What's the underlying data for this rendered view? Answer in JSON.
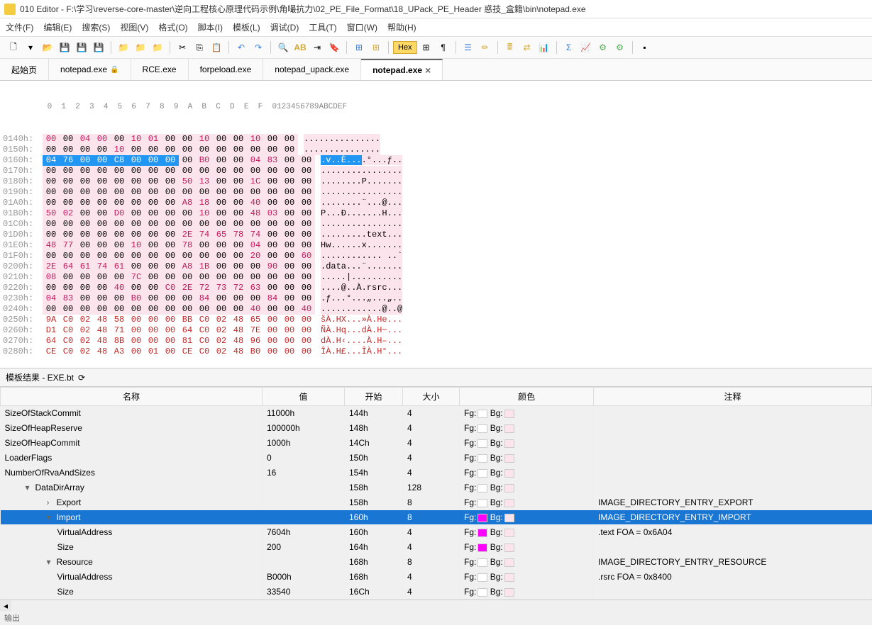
{
  "title": "010 Editor - F:\\学习\\reverse-core-master\\逆向工程核心原理代码示例\\角嘬抗力\\02_PE_File_Format\\18_UPack_PE_Header 惑技_盒籍\\bin\\notepad.exe",
  "menu": [
    {
      "l": "文件(F)"
    },
    {
      "l": "编辑(E)"
    },
    {
      "l": "搜索(S)"
    },
    {
      "l": "视图(V)"
    },
    {
      "l": "格式(O)"
    },
    {
      "l": "脚本(I)"
    },
    {
      "l": "模板(L)"
    },
    {
      "l": "调试(D)"
    },
    {
      "l": "工具(T)"
    },
    {
      "l": "窗口(W)"
    },
    {
      "l": "帮助(H)"
    }
  ],
  "toolbar_hex": "Hex",
  "tabs": [
    {
      "l": "起始页",
      "active": false
    },
    {
      "l": "notepad.exe",
      "active": false,
      "locked": true
    },
    {
      "l": "RCE.exe",
      "active": false
    },
    {
      "l": "forpeload.exe",
      "active": false
    },
    {
      "l": "notepad_upack.exe",
      "active": false
    },
    {
      "l": "notepad.exe",
      "active": true,
      "close": true
    }
  ],
  "hex_ruler_bytes": " 0  1  2  3  4  5  6  7  8  9  A  B  C  D  E  F",
  "hex_ruler_ascii": "0123456789ABCDEF",
  "hex_rows": [
    {
      "addr": "0140h:",
      "bytes": [
        "00",
        "00",
        "04",
        "00",
        "00",
        "10",
        "01",
        "00",
        "00",
        "10",
        "00",
        "00",
        "10",
        "00",
        "00"
      ],
      "bm": [
        1,
        0,
        1,
        1,
        0,
        1,
        1,
        0,
        0,
        1,
        0,
        0,
        1,
        0,
        0
      ],
      "ascii": "...............",
      "style": "pink"
    },
    {
      "addr": "0150h:",
      "bytes": [
        "00",
        "00",
        "00",
        "00",
        "10",
        "00",
        "00",
        "00",
        "00",
        "00",
        "00",
        "00",
        "00",
        "00",
        "00"
      ],
      "bm": [
        0,
        0,
        0,
        0,
        1,
        0,
        0,
        0,
        0,
        0,
        0,
        0,
        0,
        0,
        0
      ],
      "ascii": "...............",
      "style": "pink"
    },
    {
      "addr": "0160h:",
      "bytes": [
        "04",
        "76",
        "00",
        "00",
        "C8",
        "00",
        "00",
        "00",
        "00",
        "B0",
        "00",
        "00",
        "04",
        "83",
        "00",
        "00"
      ],
      "bm": [
        1,
        1,
        0,
        0,
        1,
        0,
        0,
        0,
        0,
        1,
        0,
        0,
        1,
        1,
        0,
        0
      ],
      "ascii": ".v..È....°...ƒ..",
      "style": "pink",
      "sel_start": 0,
      "sel_end": 7,
      "ascii_sel": 8
    },
    {
      "addr": "0170h:",
      "bytes": [
        "00",
        "00",
        "00",
        "00",
        "00",
        "00",
        "00",
        "00",
        "00",
        "00",
        "00",
        "00",
        "00",
        "00",
        "00",
        "00"
      ],
      "bm": [
        0,
        0,
        0,
        0,
        0,
        0,
        0,
        0,
        0,
        0,
        0,
        0,
        0,
        0,
        0,
        0
      ],
      "ascii": "................",
      "style": "pink"
    },
    {
      "addr": "0180h:",
      "bytes": [
        "00",
        "00",
        "00",
        "00",
        "00",
        "00",
        "00",
        "00",
        "50",
        "13",
        "00",
        "00",
        "1C",
        "00",
        "00",
        "00"
      ],
      "bm": [
        0,
        0,
        0,
        0,
        0,
        0,
        0,
        0,
        1,
        1,
        0,
        0,
        1,
        0,
        0,
        0
      ],
      "ascii": "........P.......",
      "style": "pink"
    },
    {
      "addr": "0190h:",
      "bytes": [
        "00",
        "00",
        "00",
        "00",
        "00",
        "00",
        "00",
        "00",
        "00",
        "00",
        "00",
        "00",
        "00",
        "00",
        "00",
        "00"
      ],
      "bm": [
        0,
        0,
        0,
        0,
        0,
        0,
        0,
        0,
        0,
        0,
        0,
        0,
        0,
        0,
        0,
        0
      ],
      "ascii": "................",
      "style": "pink"
    },
    {
      "addr": "01A0h:",
      "bytes": [
        "00",
        "00",
        "00",
        "00",
        "00",
        "00",
        "00",
        "00",
        "A8",
        "18",
        "00",
        "00",
        "40",
        "00",
        "00",
        "00"
      ],
      "bm": [
        0,
        0,
        0,
        0,
        0,
        0,
        0,
        0,
        1,
        1,
        0,
        0,
        1,
        0,
        0,
        0
      ],
      "ascii": "........¨...@...",
      "style": "pink"
    },
    {
      "addr": "01B0h:",
      "bytes": [
        "50",
        "02",
        "00",
        "00",
        "D0",
        "00",
        "00",
        "00",
        "00",
        "10",
        "00",
        "00",
        "48",
        "03",
        "00",
        "00"
      ],
      "bm": [
        1,
        1,
        0,
        0,
        1,
        0,
        0,
        0,
        0,
        1,
        0,
        0,
        1,
        1,
        0,
        0
      ],
      "ascii": "P...Ð.......H...",
      "style": "pink"
    },
    {
      "addr": "01C0h:",
      "bytes": [
        "00",
        "00",
        "00",
        "00",
        "00",
        "00",
        "00",
        "00",
        "00",
        "00",
        "00",
        "00",
        "00",
        "00",
        "00",
        "00"
      ],
      "bm": [
        0,
        0,
        0,
        0,
        0,
        0,
        0,
        0,
        0,
        0,
        0,
        0,
        0,
        0,
        0,
        0
      ],
      "ascii": "................",
      "style": "pink"
    },
    {
      "addr": "01D0h:",
      "bytes": [
        "00",
        "00",
        "00",
        "00",
        "00",
        "00",
        "00",
        "00",
        "2E",
        "74",
        "65",
        "78",
        "74",
        "00",
        "00",
        "00"
      ],
      "bm": [
        0,
        0,
        0,
        0,
        0,
        0,
        0,
        0,
        1,
        1,
        1,
        1,
        1,
        0,
        0,
        0
      ],
      "ascii": ".........text...",
      "style": "pink"
    },
    {
      "addr": "01E0h:",
      "bytes": [
        "48",
        "77",
        "00",
        "00",
        "00",
        "10",
        "00",
        "00",
        "78",
        "00",
        "00",
        "00",
        "04",
        "00",
        "00",
        "00"
      ],
      "bm": [
        1,
        1,
        0,
        0,
        0,
        1,
        0,
        0,
        1,
        0,
        0,
        0,
        1,
        0,
        0,
        0
      ],
      "ascii": "Hw......x.......",
      "style": "pink"
    },
    {
      "addr": "01F0h:",
      "bytes": [
        "00",
        "00",
        "00",
        "00",
        "00",
        "00",
        "00",
        "00",
        "00",
        "00",
        "00",
        "00",
        "20",
        "00",
        "00",
        "60"
      ],
      "bm": [
        0,
        0,
        0,
        0,
        0,
        0,
        0,
        0,
        0,
        0,
        0,
        0,
        1,
        0,
        0,
        1
      ],
      "ascii": "............ ..`",
      "style": "pink"
    },
    {
      "addr": "0200h:",
      "bytes": [
        "2E",
        "64",
        "61",
        "74",
        "61",
        "00",
        "00",
        "00",
        "A8",
        "1B",
        "00",
        "00",
        "00",
        "90",
        "00",
        "00"
      ],
      "bm": [
        1,
        1,
        1,
        1,
        1,
        0,
        0,
        0,
        1,
        1,
        0,
        0,
        0,
        1,
        0,
        0
      ],
      "ascii": ".data...¨.......",
      "style": "pink"
    },
    {
      "addr": "0210h:",
      "bytes": [
        "08",
        "00",
        "00",
        "00",
        "00",
        "7C",
        "00",
        "00",
        "00",
        "00",
        "00",
        "00",
        "00",
        "00",
        "00",
        "00"
      ],
      "bm": [
        1,
        0,
        0,
        0,
        0,
        1,
        0,
        0,
        0,
        0,
        0,
        0,
        0,
        0,
        0,
        0
      ],
      "ascii": ".....|..........",
      "style": "pink"
    },
    {
      "addr": "0220h:",
      "bytes": [
        "00",
        "00",
        "00",
        "00",
        "40",
        "00",
        "00",
        "C0",
        "2E",
        "72",
        "73",
        "72",
        "63",
        "00",
        "00",
        "00"
      ],
      "bm": [
        0,
        0,
        0,
        0,
        1,
        0,
        0,
        1,
        1,
        1,
        1,
        1,
        1,
        0,
        0,
        0
      ],
      "ascii": "....@..À.rsrc...",
      "style": "pink"
    },
    {
      "addr": "0230h:",
      "bytes": [
        "04",
        "83",
        "00",
        "00",
        "00",
        "B0",
        "00",
        "00",
        "00",
        "84",
        "00",
        "00",
        "00",
        "84",
        "00",
        "00"
      ],
      "bm": [
        1,
        1,
        0,
        0,
        0,
        1,
        0,
        0,
        0,
        1,
        0,
        0,
        0,
        1,
        0,
        0
      ],
      "ascii": ".ƒ...°...„...„..",
      "style": "pink"
    },
    {
      "addr": "0240h:",
      "bytes": [
        "00",
        "00",
        "00",
        "00",
        "00",
        "00",
        "00",
        "00",
        "00",
        "00",
        "00",
        "00",
        "40",
        "00",
        "00",
        "40"
      ],
      "bm": [
        0,
        0,
        0,
        0,
        0,
        0,
        0,
        0,
        0,
        0,
        0,
        0,
        1,
        0,
        0,
        1
      ],
      "ascii": "............@..@",
      "style": "pink"
    },
    {
      "addr": "0250h:",
      "bytes": [
        "9A",
        "C0",
        "02",
        "48",
        "58",
        "00",
        "00",
        "00",
        "BB",
        "C0",
        "02",
        "48",
        "65",
        "00",
        "00",
        "00"
      ],
      "bm": [
        0,
        0,
        0,
        0,
        0,
        0,
        0,
        0,
        0,
        0,
        0,
        0,
        0,
        0,
        0,
        0
      ],
      "ascii": "šÀ.HX...»À.He...",
      "style": "red"
    },
    {
      "addr": "0260h:",
      "bytes": [
        "D1",
        "C0",
        "02",
        "48",
        "71",
        "00",
        "00",
        "00",
        "64",
        "C0",
        "02",
        "48",
        "7E",
        "00",
        "00",
        "00"
      ],
      "bm": [
        0,
        0,
        0,
        0,
        0,
        0,
        0,
        0,
        0,
        0,
        0,
        0,
        0,
        0,
        0,
        0
      ],
      "ascii": "ÑÀ.Hq...dÀ.H~...",
      "style": "red"
    },
    {
      "addr": "0270h:",
      "bytes": [
        "64",
        "C0",
        "02",
        "48",
        "8B",
        "00",
        "00",
        "00",
        "81",
        "C0",
        "02",
        "48",
        "96",
        "00",
        "00",
        "00"
      ],
      "bm": [
        0,
        0,
        0,
        0,
        0,
        0,
        0,
        0,
        0,
        0,
        0,
        0,
        0,
        0,
        0,
        0
      ],
      "ascii": "dÀ.H‹....À.H–...",
      "style": "red"
    },
    {
      "addr": "0280h:",
      "bytes": [
        "CE",
        "C0",
        "02",
        "48",
        "A3",
        "00",
        "01",
        "00",
        "CE",
        "C0",
        "02",
        "48",
        "B0",
        "00",
        "00",
        "00"
      ],
      "bm": [
        0,
        0,
        0,
        0,
        0,
        0,
        0,
        0,
        0,
        0,
        0,
        0,
        0,
        0,
        0,
        0
      ],
      "ascii": "ÎÀ.H£...ÎÀ.H°...",
      "style": "red"
    }
  ],
  "panel": {
    "title": "模板结果 - EXE.bt",
    "headers": {
      "name": "名称",
      "value": "值",
      "start": "开始",
      "size": "大小",
      "color": "颜色",
      "comment": "注释"
    },
    "fg_label": "Fg:",
    "bg_label": "Bg:"
  },
  "rows": [
    {
      "name": "SizeOfStackCommit",
      "value": "11000h",
      "start": "144h",
      "size": "4",
      "fg": "empty",
      "bg": "pink",
      "comment": "",
      "indent": "tree-cell"
    },
    {
      "name": "SizeOfHeapReserve",
      "value": "100000h",
      "start": "148h",
      "size": "4",
      "fg": "empty",
      "bg": "pink",
      "comment": "",
      "indent": "tree-cell"
    },
    {
      "name": "SizeOfHeapCommit",
      "value": "1000h",
      "start": "14Ch",
      "size": "4",
      "fg": "empty",
      "bg": "pink",
      "comment": "",
      "indent": "tree-cell"
    },
    {
      "name": "LoaderFlags",
      "value": "0",
      "start": "150h",
      "size": "4",
      "fg": "empty",
      "bg": "pink",
      "comment": "",
      "indent": "tree-cell"
    },
    {
      "name": "NumberOfRvaAndSizes",
      "value": "16",
      "start": "154h",
      "size": "4",
      "fg": "empty",
      "bg": "pink",
      "comment": "",
      "indent": "tree-cell"
    },
    {
      "name": "DataDirArray",
      "value": "",
      "start": "158h",
      "size": "128",
      "fg": "empty",
      "bg": "pink",
      "comment": "",
      "indent": "tree-cell l1",
      "exp": "▾"
    },
    {
      "name": "Export",
      "value": "",
      "start": "158h",
      "size": "8",
      "fg": "empty",
      "bg": "pink",
      "comment": "IMAGE_DIRECTORY_ENTRY_EXPORT",
      "indent": "tree-cell l2",
      "exp": "›"
    },
    {
      "name": "Import",
      "value": "",
      "start": "160h",
      "size": "8",
      "fg": "mag",
      "bg": "pink",
      "comment": "IMAGE_DIRECTORY_ENTRY_IMPORT",
      "indent": "tree-cell l2",
      "exp": "▾",
      "selected": true
    },
    {
      "name": "VirtualAddress",
      "value": "7604h",
      "start": "160h",
      "size": "4",
      "fg": "mag",
      "bg": "pink",
      "comment": ".text FOA = 0x6A04",
      "indent": "tree-cell l3"
    },
    {
      "name": "Size",
      "value": "200",
      "start": "164h",
      "size": "4",
      "fg": "mag",
      "bg": "pink",
      "comment": "",
      "indent": "tree-cell l3"
    },
    {
      "name": "Resource",
      "value": "",
      "start": "168h",
      "size": "8",
      "fg": "empty",
      "bg": "pink",
      "comment": "IMAGE_DIRECTORY_ENTRY_RESOURCE",
      "indent": "tree-cell l2",
      "exp": "▾"
    },
    {
      "name": "VirtualAddress",
      "value": "B000h",
      "start": "168h",
      "size": "4",
      "fg": "empty",
      "bg": "pink",
      "comment": ".rsrc FOA = 0x8400",
      "indent": "tree-cell l3"
    },
    {
      "name": "Size",
      "value": "33540",
      "start": "16Ch",
      "size": "4",
      "fg": "empty",
      "bg": "pink",
      "comment": "",
      "indent": "tree-cell l3"
    }
  ],
  "footer": "输出"
}
